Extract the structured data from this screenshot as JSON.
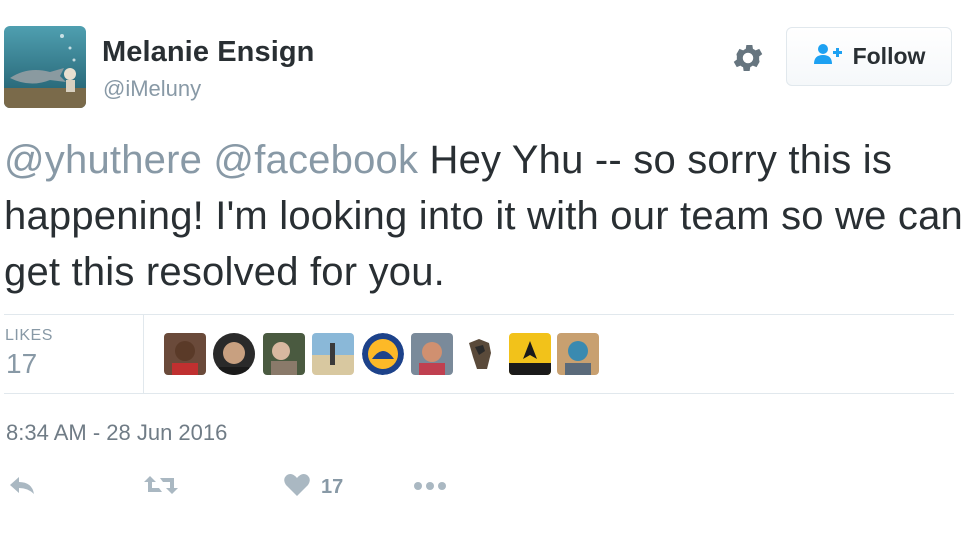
{
  "author": {
    "name": "Melanie Ensign",
    "handle": "@iMeluny"
  },
  "follow_button": {
    "label": "Follow"
  },
  "tweet": {
    "mentions": [
      "@yhuthere",
      "@facebook"
    ],
    "body": "Hey Yhu -- so sorry this is happening! I'm looking into it with our team so we can get this resolved for you."
  },
  "stats": {
    "likes_label": "LIKES",
    "likes_count": "17"
  },
  "likers": [
    {
      "name": "liker-1"
    },
    {
      "name": "liker-2"
    },
    {
      "name": "liker-3"
    },
    {
      "name": "liker-4"
    },
    {
      "name": "liker-5"
    },
    {
      "name": "liker-6"
    },
    {
      "name": "liker-7"
    },
    {
      "name": "liker-8"
    },
    {
      "name": "liker-9"
    }
  ],
  "timestamp": "8:34 AM - 28 Jun 2016",
  "actions": {
    "reply_icon": "reply-icon",
    "retweet_icon": "retweet-icon",
    "like_icon": "heart-icon",
    "like_count": "17",
    "more_icon": "more-icon"
  },
  "colors": {
    "text": "#292f33",
    "muted": "#8899a6",
    "follow_icon": "#1da1f2"
  }
}
